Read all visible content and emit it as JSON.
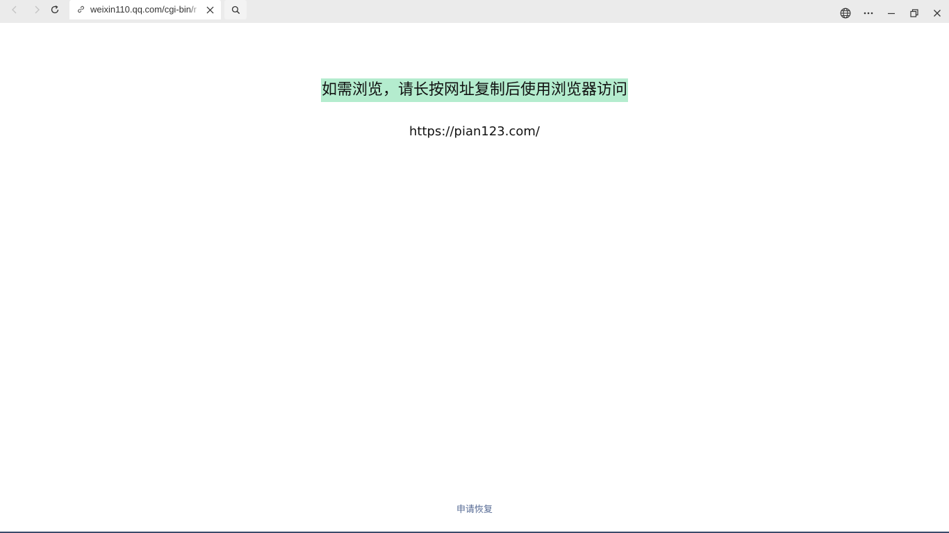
{
  "browser": {
    "tab": {
      "url": "weixin110.qq.com/cgi-bin/r"
    },
    "icons": {
      "back": "back-arrow-icon",
      "forward": "forward-arrow-icon",
      "reload": "reload-icon",
      "link": "link-icon",
      "close": "close-icon",
      "search": "search-icon",
      "globe": "globe-icon",
      "more": "more-icon",
      "minimize": "minimize-icon",
      "restore": "restore-icon",
      "window_close": "window-close-icon"
    }
  },
  "page": {
    "headline": "如需浏览，请长按网址复制后使用浏览器访问",
    "url": "https://pian123.com/",
    "footer_link": "申请恢复"
  },
  "colors": {
    "highlight": "#b4ecce",
    "link": "#576b95",
    "titlebar": "#ebebeb"
  }
}
